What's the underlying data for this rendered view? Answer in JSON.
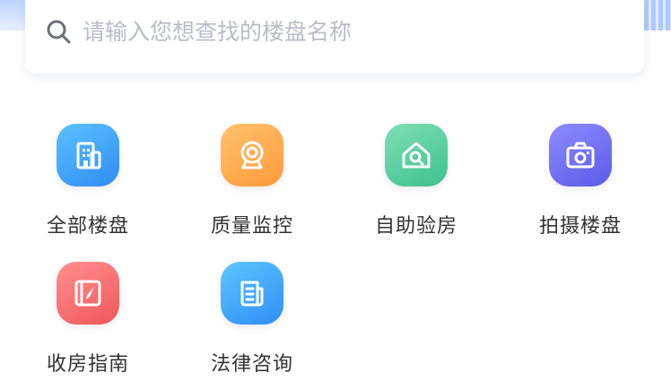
{
  "search": {
    "placeholder": "请输入您想查找的楼盘名称",
    "value": ""
  },
  "menu": {
    "items": [
      {
        "label": "全部楼盘",
        "icon": "building-icon",
        "color": "#2f8cf5"
      },
      {
        "label": "质量监控",
        "icon": "webcam-icon",
        "color": "#ff9a3c"
      },
      {
        "label": "自助验房",
        "icon": "house-search-icon",
        "color": "#3dc08e"
      },
      {
        "label": "拍摄楼盘",
        "icon": "camera-icon",
        "color": "#5a5be8"
      },
      {
        "label": "收房指南",
        "icon": "compass-guide-icon",
        "color": "#f0575a"
      },
      {
        "label": "法律咨询",
        "icon": "document-icon",
        "color": "#2f8ef5"
      }
    ]
  }
}
